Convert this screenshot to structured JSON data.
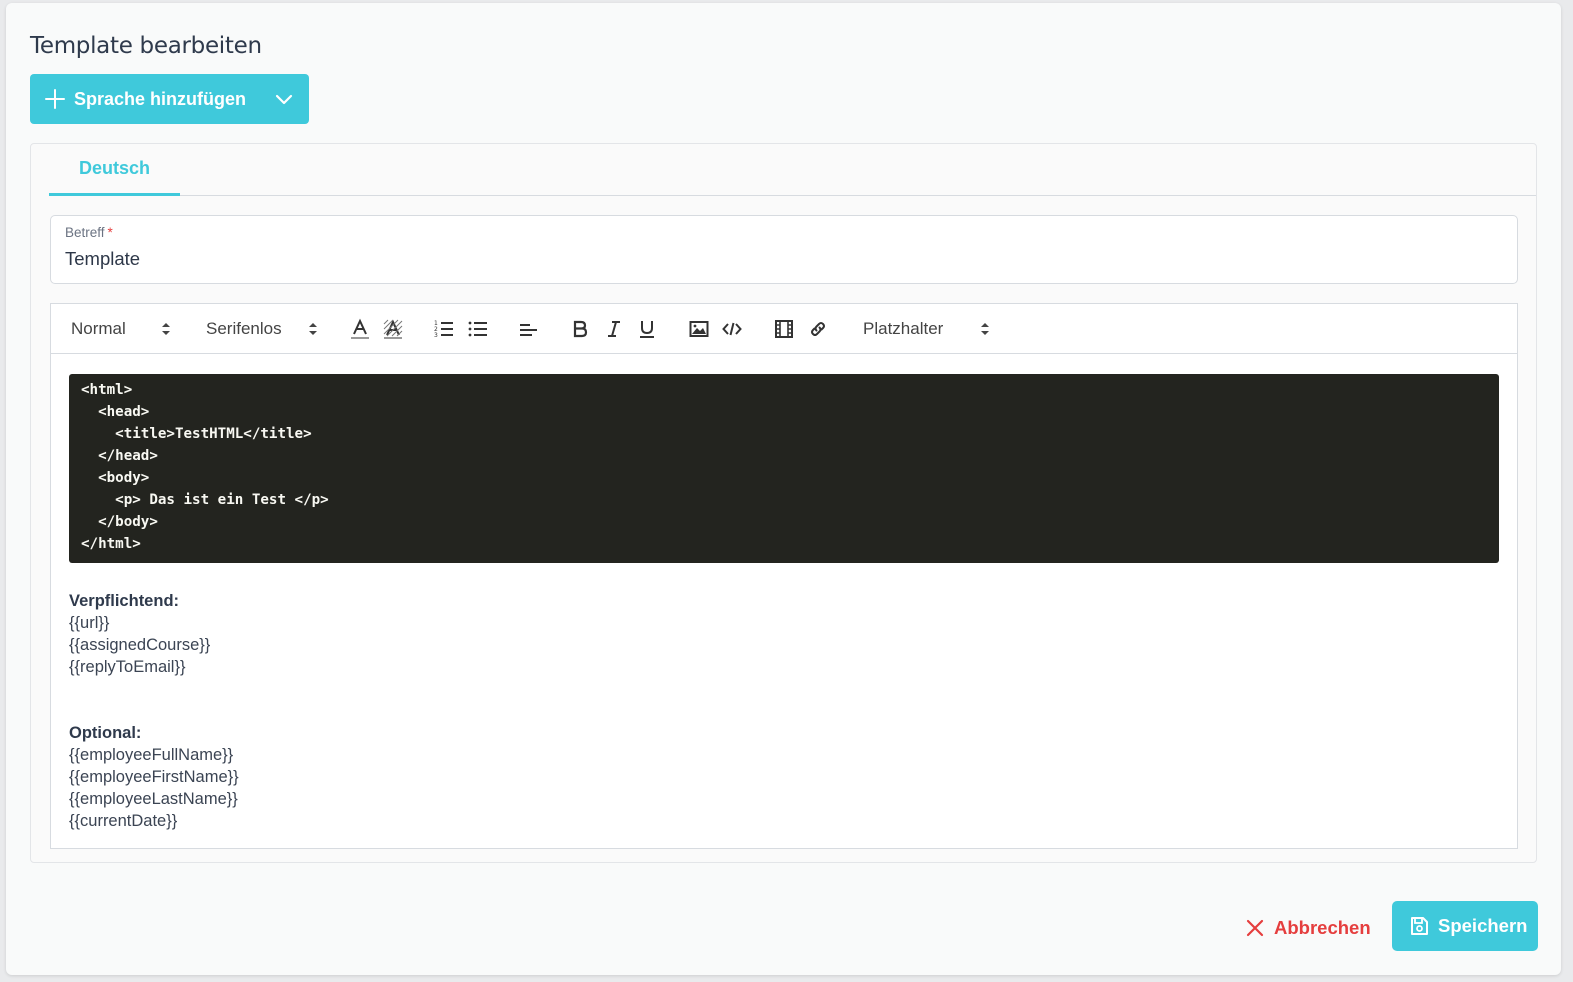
{
  "title": "Template bearbeiten",
  "add_language": {
    "label": "Sprache hinzufügen",
    "plus_icon": "plus-icon",
    "chevron_icon": "chevron-down-icon"
  },
  "tabs": [
    {
      "label": "Deutsch",
      "active": true
    }
  ],
  "subject": {
    "label": "Betreff",
    "required_mark": "*",
    "value": "Template"
  },
  "toolbar": {
    "header_select": "Normal",
    "font_select": "Serifenlos",
    "placeholder_select": "Platzhalter",
    "icons": [
      "text-color-icon",
      "background-color-icon",
      "ordered-list-icon",
      "bullet-list-icon",
      "align-icon",
      "bold-icon",
      "italic-icon",
      "underline-icon",
      "image-icon",
      "code-block-icon",
      "video-icon",
      "link-icon"
    ]
  },
  "code_lines": [
    "<html>",
    "  <head>",
    "    <title>TestHTML</title>",
    "  </head>",
    "  <body>",
    "    <p> Das ist ein Test </p>",
    "  </body>",
    "</html>"
  ],
  "required_section": {
    "heading": "Verpflichtend:",
    "items": [
      "{{url}}",
      "{{assignedCourse}}",
      "{{replyToEmail}}"
    ]
  },
  "optional_section": {
    "heading": "Optional:",
    "items": [
      "{{employeeFullName}}",
      "{{employeeFirstName}}",
      "{{employeeLastName}}",
      "{{currentDate}}"
    ]
  },
  "footer": {
    "cancel_label": "Abbrechen",
    "save_label": "Speichern"
  },
  "colors": {
    "accent": "#3fc9db",
    "danger": "#e53e3e",
    "code_bg": "#23241f"
  }
}
